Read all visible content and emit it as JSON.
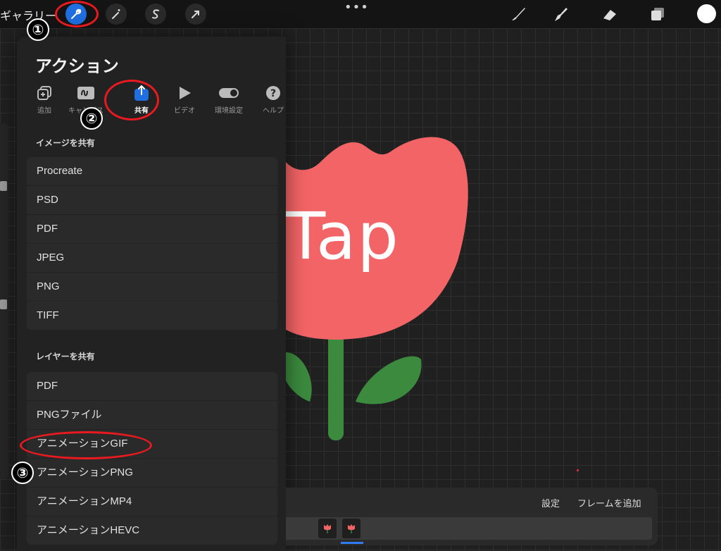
{
  "topbar": {
    "gallery_label": "ギャラリー",
    "left_tools": [
      {
        "icon": "wrench-icon",
        "active": true
      },
      {
        "icon": "magic-wand-icon",
        "active": false
      },
      {
        "icon": "selection-s-icon",
        "active": false
      },
      {
        "icon": "arrow-transform-icon",
        "active": false
      }
    ],
    "more": "•••",
    "right_tools": [
      "brush-icon",
      "smudge-icon",
      "eraser-icon",
      "layers-icon"
    ],
    "current_color": "#ffffff"
  },
  "panel": {
    "title": "アクション",
    "tabs": [
      {
        "label": "追加",
        "icon": "add-icon"
      },
      {
        "label": "キャンバス",
        "icon": "canvas-icon"
      },
      {
        "label": "共有",
        "icon": "share-icon",
        "active": true
      },
      {
        "label": "ビデオ",
        "icon": "video-play-icon"
      },
      {
        "label": "環境設定",
        "icon": "toggle-icon"
      },
      {
        "label": "ヘルプ",
        "icon": "help-icon"
      }
    ],
    "share_image": {
      "heading": "イメージを共有",
      "items": [
        "Procreate",
        "PSD",
        "PDF",
        "JPEG",
        "PNG",
        "TIFF"
      ]
    },
    "share_layers": {
      "heading": "レイヤーを共有",
      "items": [
        "PDF",
        "PNGファイル",
        "アニメーションGIF",
        "アニメーションPNG",
        "アニメーションMP4",
        "アニメーションHEVC"
      ]
    }
  },
  "canvas": {
    "art_text": "Tap",
    "tulip_color": "#f36466",
    "leaf_color": "#3b8a3e"
  },
  "timeline": {
    "settings_label": "設定",
    "add_frame_label": "フレームを追加",
    "frame_count": 2
  },
  "annotations": [
    "①",
    "②",
    "③"
  ],
  "accent_color": "#1f6fe0",
  "annotation_color": "#e8191f"
}
